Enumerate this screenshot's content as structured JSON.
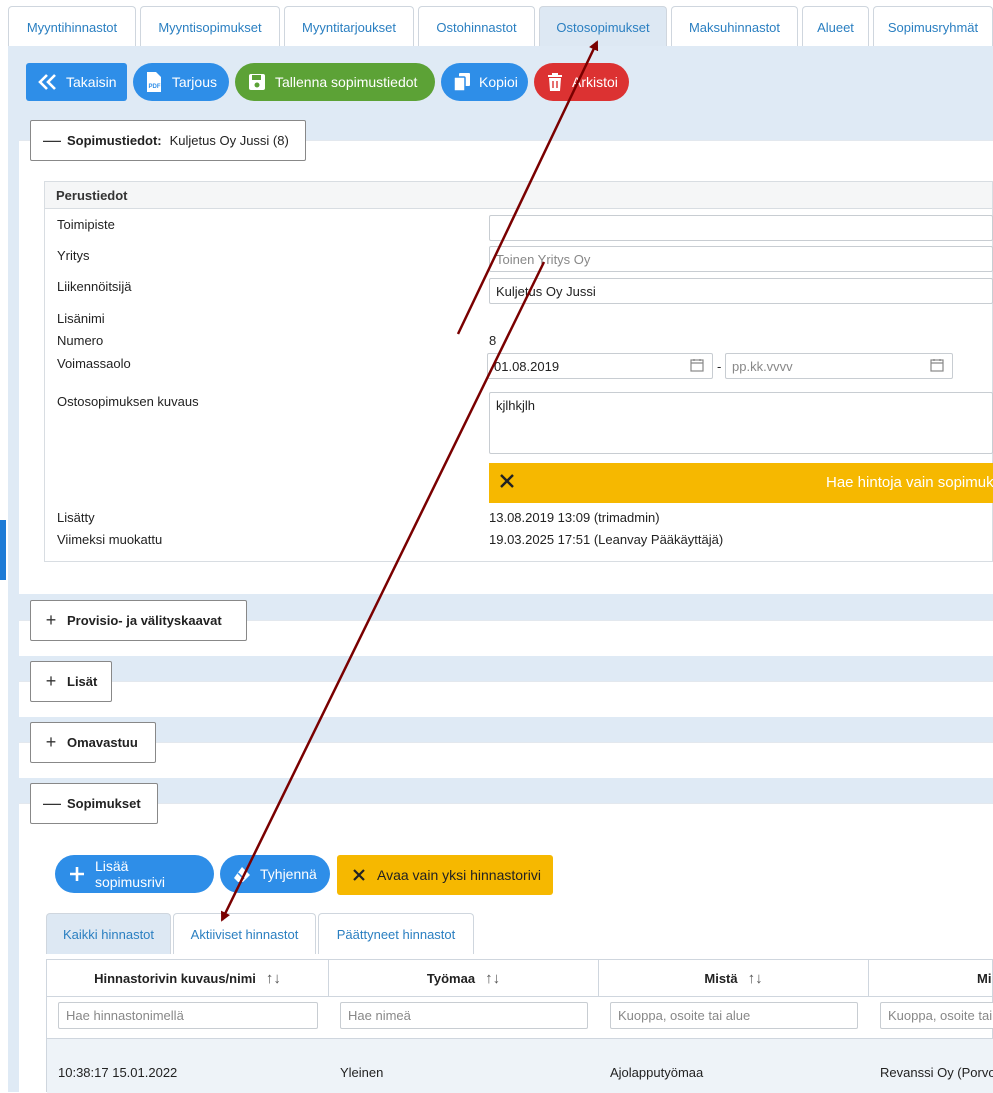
{
  "tabs": [
    {
      "label": "Myyntihinnastot"
    },
    {
      "label": "Myyntisopimukset"
    },
    {
      "label": "Myyntitarjoukset"
    },
    {
      "label": "Ostohinnastot"
    },
    {
      "label": "Ostosopimukset",
      "active": true
    },
    {
      "label": "Maksuhinnastot"
    },
    {
      "label": "Alueet"
    },
    {
      "label": "Sopimusryhmät"
    }
  ],
  "toolbar": {
    "back": "Takaisin",
    "pdf": "Tarjous",
    "save": "Tallenna sopimustiedot",
    "copy": "Kopioi",
    "archive": "Arkistoi"
  },
  "contract": {
    "header_label": "Sopimustiedot:",
    "header_value": "Kuljetus Oy Jussi (8)",
    "section_title": "Perustiedot",
    "labels": {
      "office": "Toimipiste",
      "company": "Yritys",
      "operator": "Liikennöitsijä",
      "extra_name": "Lisänimi",
      "number": "Numero",
      "validity": "Voimassaolo",
      "description": "Ostosopimuksen kuvaus",
      "added": "Lisätty",
      "modified": "Viimeksi muokattu"
    },
    "office_value": "",
    "company_placeholder": "Toinen Yritys Oy",
    "operator_value": "Kuljetus Oy Jussi",
    "number_value": "8",
    "valid_from": "01.08.2019",
    "valid_sep": "-",
    "valid_to_placeholder": "pp.kk.vvvv",
    "description_value": "kjlhkjlh",
    "warning_text": "Hae hintoja vain sopimuk",
    "added_value": "13.08.2019 13:09 (trimadmin)",
    "modified_value": "19.03.2025 17:51 (Leanvay Pääkäyttäjä)"
  },
  "sections": {
    "commission": "Provisio- ja välityskaavat",
    "extras": "Lisät",
    "deductible": "Omavastuu",
    "agreements": "Sopimukset"
  },
  "agreements": {
    "add": "Lisää sopimusrivi",
    "clear": "Tyhjennä",
    "open_one": "Avaa vain yksi hinnastorivi",
    "subtabs": [
      "Kaikki hinnastot",
      "Aktiiviset hinnastot",
      "Päättyneet hinnastot"
    ],
    "columns": [
      "Hinnastorivin kuvaus/nimi",
      "Työmaa",
      "Mistä",
      "Mi"
    ],
    "filters": [
      "Hae hinnastonimellä",
      "Hae nimeä",
      "Kuoppa, osoite tai alue",
      "Kuoppa, osoite tai"
    ],
    "row": [
      "10:38:17 15.01.2022",
      "Yleinen",
      "Ajolapputyömaa",
      "Revanssi Oy (Porvo"
    ]
  },
  "colors": {
    "accent": "#2e8ee8",
    "arrow": "#7a0000",
    "warning": "#f6b800"
  }
}
